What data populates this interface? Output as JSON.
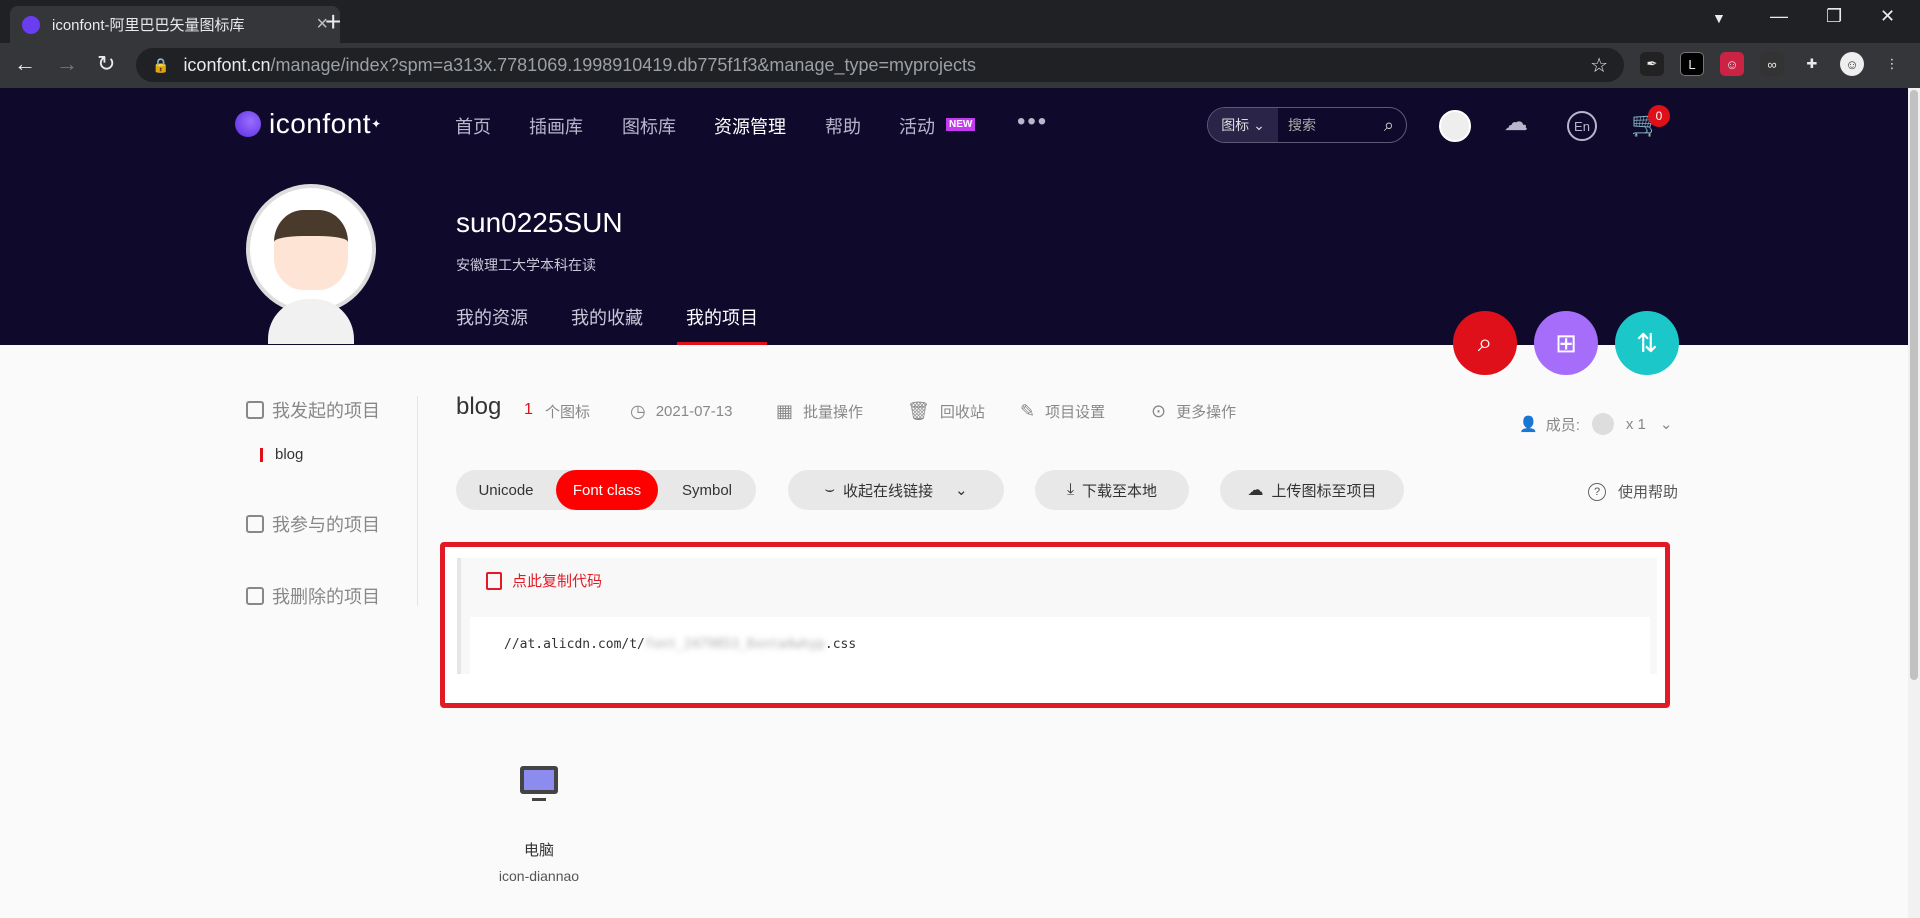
{
  "browser": {
    "tab_title": "iconfont-阿里巴巴矢量图标库",
    "url_host": "iconfont.cn",
    "url_path": "/manage/index?spm=a313x.7781069.1998910419.db775f1f3&manage_type=myprojects"
  },
  "site": {
    "logo_text": "iconfont",
    "nav": [
      "首页",
      "插画库",
      "图标库",
      "资源管理",
      "帮助",
      "活动"
    ],
    "nav_badge": "NEW",
    "more": "•••",
    "search_type": "图标",
    "search_placeholder": "搜索",
    "lang_label": "En",
    "cart_count": "0"
  },
  "profile": {
    "username": "sun0225SUN",
    "description": "安徽理工大学本科在读",
    "tabs": [
      "我的资源",
      "我的收藏",
      "我的项目"
    ]
  },
  "sidebar": {
    "group_started": "我发起的项目",
    "project_item": "blog",
    "group_joined": "我参与的项目",
    "group_deleted": "我删除的项目"
  },
  "project": {
    "name": "blog",
    "icon_count": "1",
    "icon_count_unit": "个图标",
    "date": "2021-07-13",
    "actions": [
      "批量操作",
      "回收站",
      "项目设置",
      "更多操作"
    ],
    "members_label": "成员:",
    "members_count": "x 1"
  },
  "controls": {
    "modes": [
      "Unicode",
      "Font class",
      "Symbol"
    ],
    "collapse_link": "收起在线链接",
    "download": "下载至本地",
    "upload": "上传图标至项目",
    "help": "使用帮助"
  },
  "code": {
    "copy_label": "点此复制代码",
    "url_prefix": "//at.alicdn.com/t/",
    "url_hidden": "font_2479853_8xnta4whyp",
    "url_suffix": ".css"
  },
  "icons": [
    {
      "name": "电脑",
      "class": "icon-diannao"
    }
  ]
}
